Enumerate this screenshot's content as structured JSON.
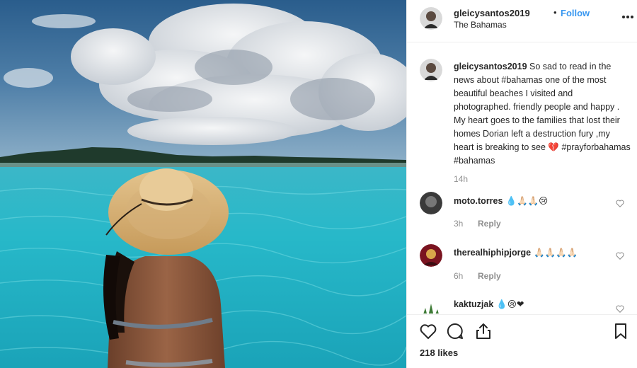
{
  "colors": {
    "accent_follow": "#3897f0",
    "text_primary": "#262626",
    "text_secondary": "#8e8e8e",
    "divider": "#efefef"
  },
  "header": {
    "username": "gleicysantos2019",
    "separator": "•",
    "follow_label": "Follow",
    "location": "The Bahamas",
    "more_icon": "more-horizontal-icon"
  },
  "caption": {
    "username": "gleicysantos2019",
    "text": "So sad to read in the news about #bahamas one of the most beautiful beaches I visited and photographed. friendly people and happy . My heart goes to the families that lost their homes Dorian left a destruction fury ,my heart is breaking to see 💔 #prayforbahamas #bahamas",
    "time": "14h"
  },
  "comments": [
    {
      "username": "moto.torres",
      "text": "💧🙏🏻🙏🏻😢",
      "time": "3h",
      "reply_label": "Reply"
    },
    {
      "username": "therealhiphipjorge",
      "text": "🙏🏻🙏🏻🙏🏻🙏🏻",
      "time": "6h",
      "reply_label": "Reply"
    },
    {
      "username": "kaktuzjak",
      "text": "💧😢❤",
      "time": "",
      "reply_label": ""
    }
  ],
  "actions": {
    "icons": [
      "heart-icon",
      "comment-icon",
      "share-icon",
      "bookmark-icon"
    ],
    "likes": "218 likes"
  }
}
